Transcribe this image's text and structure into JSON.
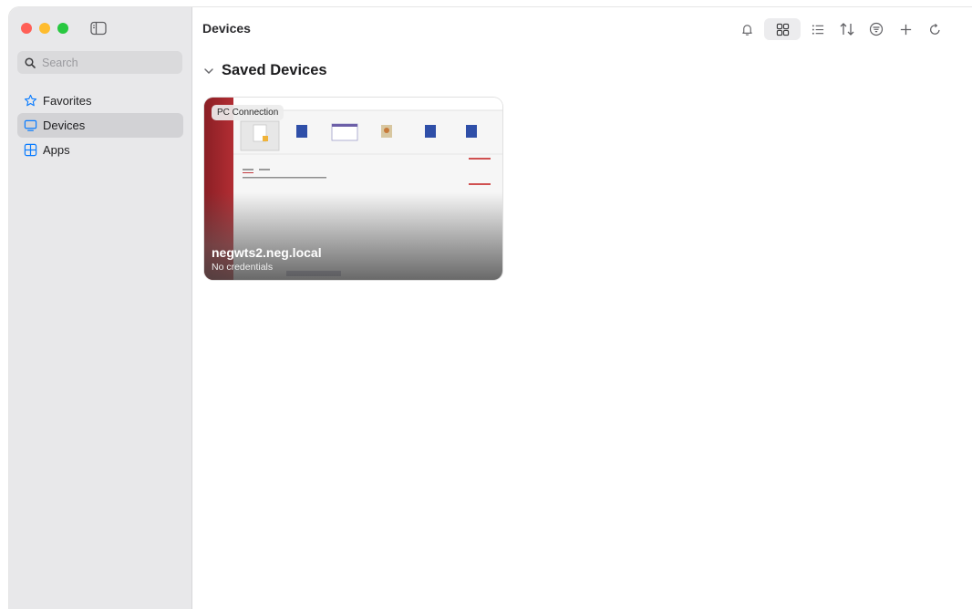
{
  "sidebar": {
    "search_placeholder": "Search",
    "items": [
      {
        "label": "Favorites",
        "icon": "star-icon",
        "active": false
      },
      {
        "label": "Devices",
        "icon": "monitor-icon",
        "active": true
      },
      {
        "label": "Apps",
        "icon": "apps-grid-icon",
        "active": false
      }
    ]
  },
  "header": {
    "title": "Devices",
    "toolbar": [
      {
        "icon": "bell-icon"
      },
      {
        "icon": "grid-view-icon",
        "selected": true
      },
      {
        "icon": "list-view-icon"
      },
      {
        "icon": "sort-icon"
      },
      {
        "icon": "filter-icon"
      },
      {
        "icon": "plus-icon"
      },
      {
        "icon": "refresh-icon"
      }
    ]
  },
  "section": {
    "title": "Saved Devices",
    "cards": [
      {
        "badge": "PC Connection",
        "name": "negwts2.neg.local",
        "status": "No credentials"
      }
    ]
  },
  "colors": {
    "accent": "#0a7cff",
    "sidebar_bg": "#e8e8ea",
    "thumb_red": "#a4262c"
  }
}
